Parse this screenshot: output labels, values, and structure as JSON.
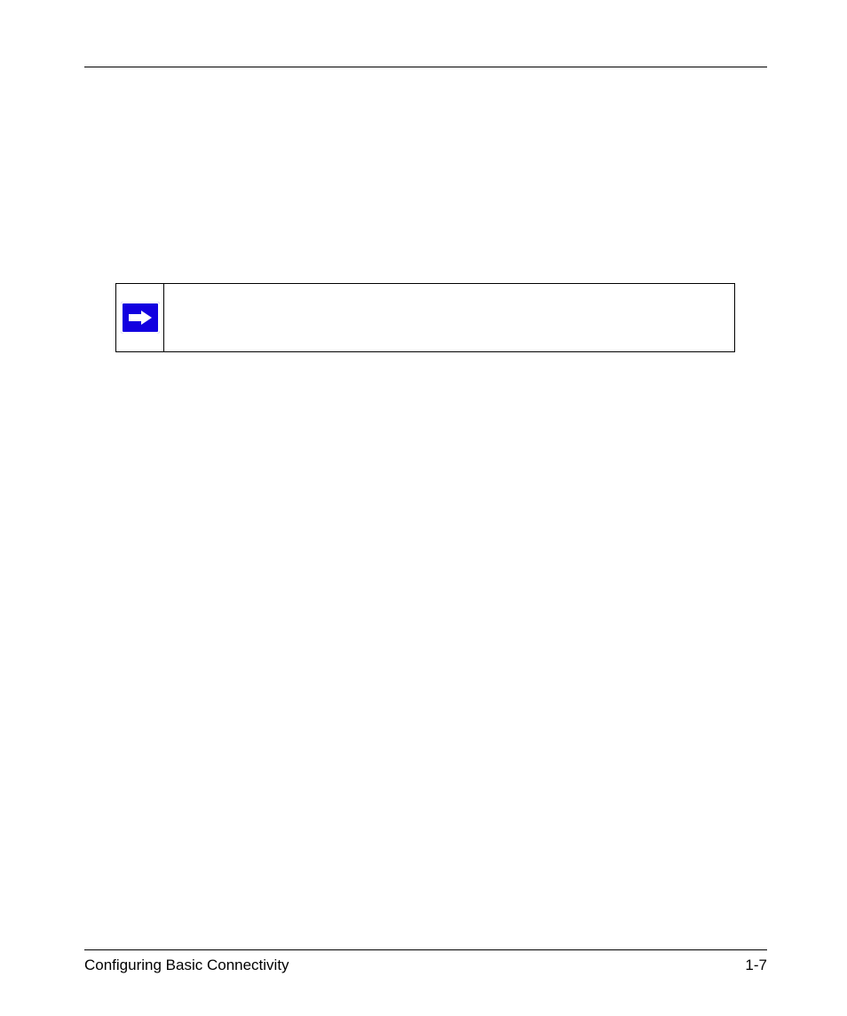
{
  "footer": {
    "left": "Configuring Basic Connectivity",
    "right": "1-7"
  },
  "note": {
    "text": ""
  }
}
